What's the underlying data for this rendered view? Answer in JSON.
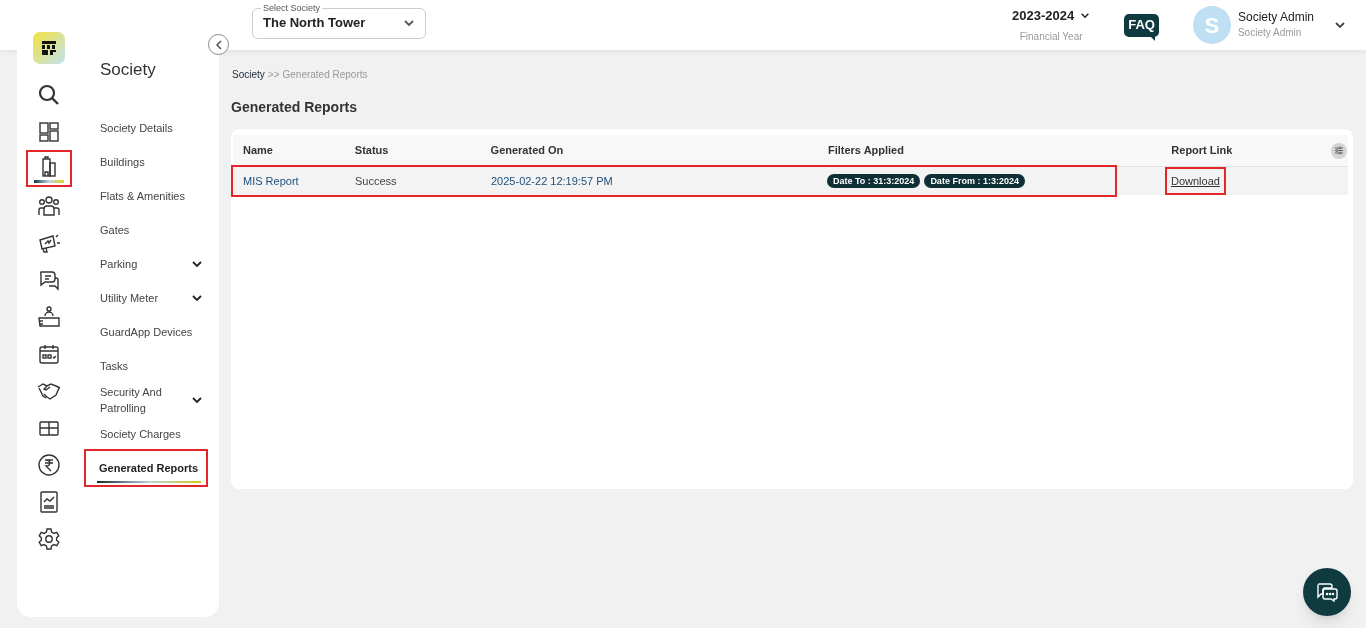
{
  "rail": [
    {
      "kind": "search",
      "selected": false,
      "highlighted": false
    },
    {
      "kind": "grid",
      "selected": false,
      "highlighted": false
    },
    {
      "kind": "building",
      "selected": true,
      "highlighted": true
    },
    {
      "kind": "people",
      "selected": false,
      "highlighted": false
    },
    {
      "kind": "megaphone",
      "selected": false,
      "highlighted": false
    },
    {
      "kind": "chat",
      "selected": false,
      "highlighted": false
    },
    {
      "kind": "desk",
      "selected": false,
      "highlighted": false
    },
    {
      "kind": "calendar",
      "selected": false,
      "highlighted": false
    },
    {
      "kind": "handshake",
      "selected": false,
      "highlighted": false
    },
    {
      "kind": "box",
      "selected": false,
      "highlighted": false
    },
    {
      "kind": "rupee",
      "selected": false,
      "highlighted": false
    },
    {
      "kind": "report",
      "selected": false,
      "highlighted": false
    },
    {
      "kind": "gear",
      "selected": false,
      "highlighted": false
    }
  ],
  "nav": {
    "title": "Society",
    "items": [
      {
        "label": "Society Details",
        "expandable": false,
        "selected": false,
        "highlighted": false
      },
      {
        "label": "Buildings",
        "expandable": false,
        "selected": false,
        "highlighted": false
      },
      {
        "label": "Flats & Amenities",
        "expandable": false,
        "selected": false,
        "highlighted": false
      },
      {
        "label": "Gates",
        "expandable": false,
        "selected": false,
        "highlighted": false
      },
      {
        "label": "Parking",
        "expandable": true,
        "selected": false,
        "highlighted": false
      },
      {
        "label": "Utility Meter",
        "expandable": true,
        "selected": false,
        "highlighted": false
      },
      {
        "label": "GuardApp Devices",
        "expandable": false,
        "selected": false,
        "highlighted": false
      },
      {
        "label": "Tasks",
        "expandable": false,
        "selected": false,
        "highlighted": false
      },
      {
        "label": "Security And Patrolling",
        "expandable": true,
        "selected": false,
        "highlighted": false
      },
      {
        "label": "Society Charges",
        "expandable": false,
        "selected": false,
        "highlighted": false
      },
      {
        "label": "Generated Reports",
        "expandable": false,
        "selected": true,
        "highlighted": true
      }
    ]
  },
  "header": {
    "society_select": {
      "label": "Select Society",
      "value": "The North Tower"
    },
    "financial_year": {
      "value": "2023-2024",
      "label": "Financial Year"
    },
    "faq": "FAQ",
    "user": {
      "initial": "S",
      "name": "Society Admin",
      "role": "Society Admin"
    }
  },
  "breadcrumb": {
    "parent": "Society",
    "separator": ">>",
    "current": "Generated Reports"
  },
  "page_title": "Generated Reports",
  "table": {
    "columns": [
      "Name",
      "Status",
      "Generated On",
      "Filters Applied",
      "Report Link"
    ],
    "rows": [
      {
        "name": "MIS Report",
        "status": "Success",
        "generated_on": "2025-02-22 12:19:57 PM",
        "filters": [
          "Date To : 31:3:2024",
          "Date From : 1:3:2024"
        ],
        "link": "Download",
        "highlighted": true,
        "link_highlighted": true
      }
    ]
  }
}
